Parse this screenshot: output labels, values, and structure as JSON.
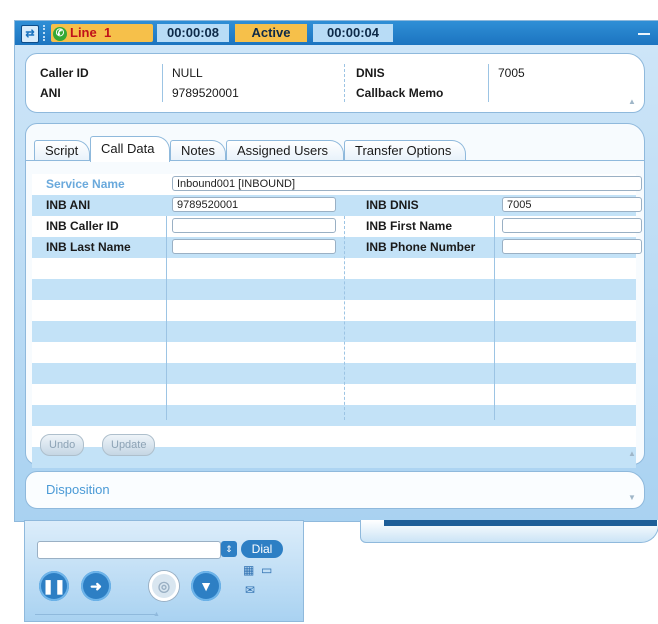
{
  "topbar": {
    "line_label": "Line",
    "line_number": "1",
    "call_timer": "00:00:08",
    "status": "Active",
    "status_timer": "00:00:04"
  },
  "caller": {
    "caller_id_label": "Caller ID",
    "caller_id_value": "NULL",
    "ani_label": "ANI",
    "ani_value": "9789520001",
    "dnis_label": "DNIS",
    "dnis_value": "7005",
    "callback_memo_label": "Callback Memo",
    "callback_memo_value": ""
  },
  "tabs": [
    {
      "label": "Script"
    },
    {
      "label": "Call Data"
    },
    {
      "label": "Notes"
    },
    {
      "label": "Assigned Users"
    },
    {
      "label": "Transfer Options"
    }
  ],
  "call_data": {
    "service_name_label": "Service Name",
    "service_name_value": "Inbound001 [INBOUND]",
    "inb_ani_label": "INB ANI",
    "inb_ani_value": "9789520001",
    "inb_dnis_label": "INB DNIS",
    "inb_dnis_value": "7005",
    "inb_caller_id_label": "INB Caller ID",
    "inb_caller_id_value": "",
    "inb_first_name_label": "INB First Name",
    "inb_first_name_value": "",
    "inb_last_name_label": "INB Last Name",
    "inb_last_name_value": "",
    "inb_phone_number_label": "INB Phone Number",
    "inb_phone_number_value": ""
  },
  "buttons": {
    "undo": "Undo",
    "update": "Update",
    "dial": "Dial"
  },
  "disposition": {
    "label": "Disposition"
  },
  "colors": {
    "accent_blue": "#1c74c0",
    "status_amber": "#f6c04a",
    "status_red": "#c0121a",
    "row_alt": "#c3e2f7"
  },
  "icons": [
    "window-icon",
    "phone-icon",
    "minimize-icon",
    "collapse-icon",
    "dropdown-icon",
    "pause-icon",
    "transfer-icon",
    "record-icon",
    "hangup-icon",
    "keypad-icon",
    "folder-icon",
    "mail-icon"
  ]
}
